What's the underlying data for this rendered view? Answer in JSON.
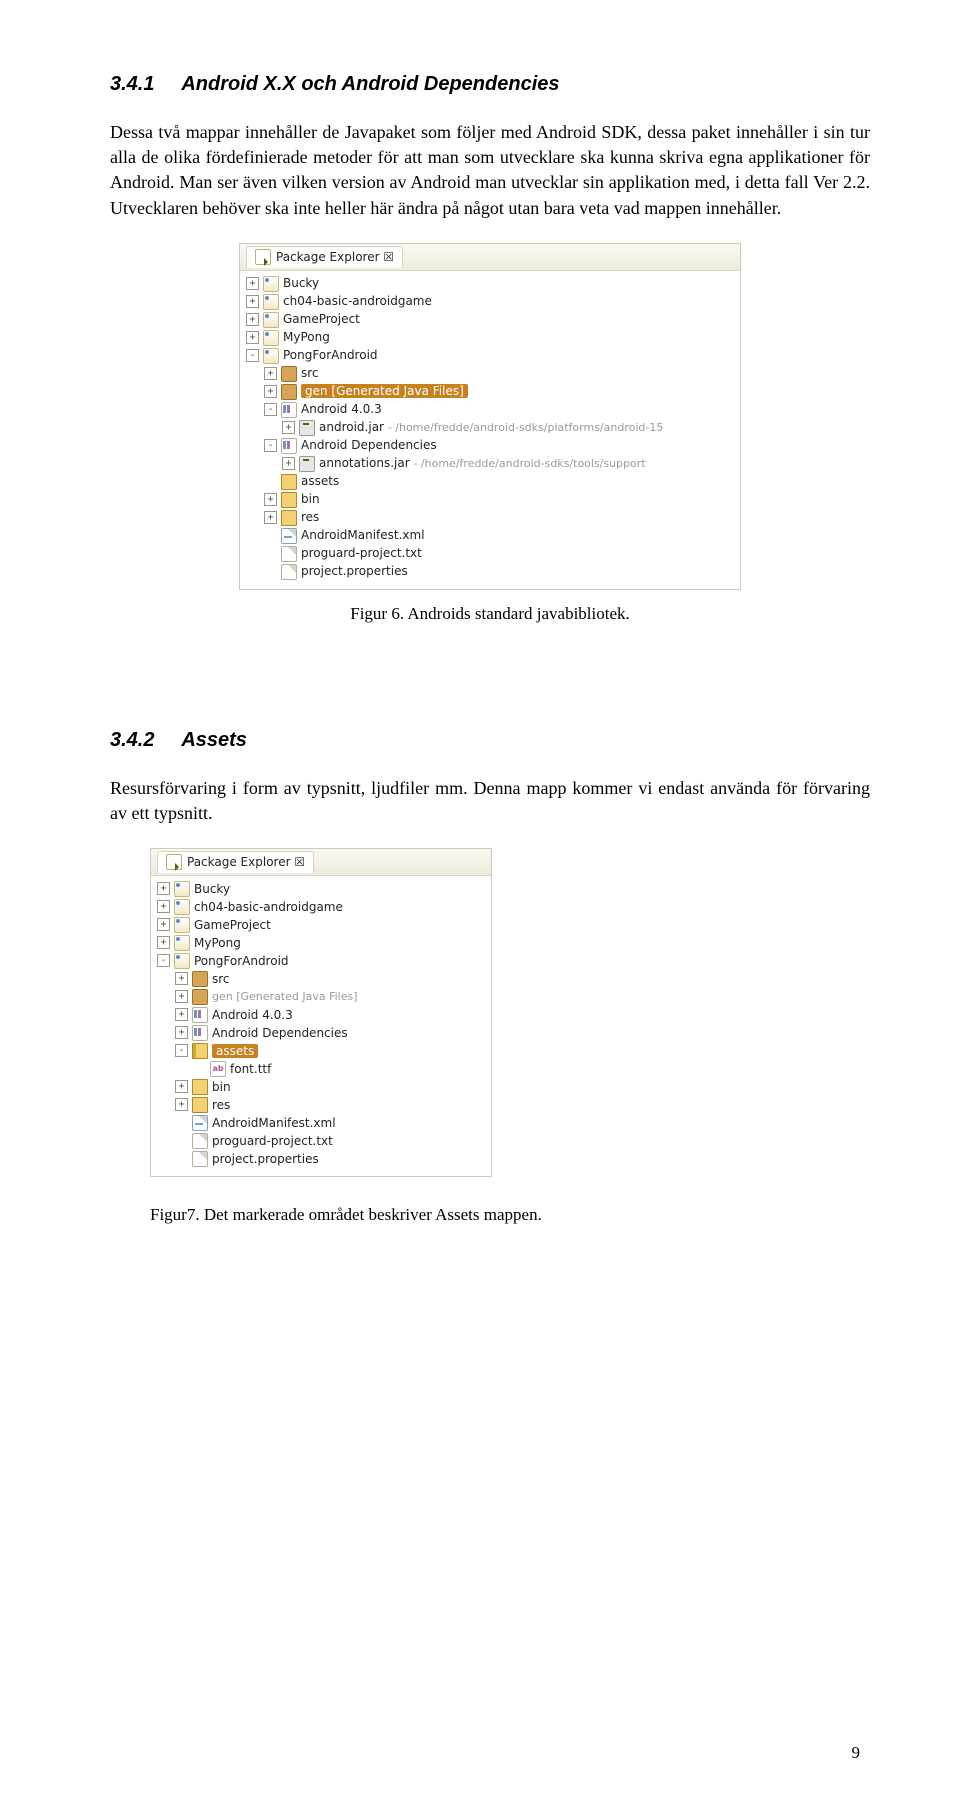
{
  "heading1": {
    "num": "3.4.1",
    "title": "Android X.X och Android Dependencies"
  },
  "para1": "Dessa två mappar innehåller de Javapaket som följer med Android SDK, dessa paket innehåller i sin tur alla de olika fördefinierade metoder för att man som utvecklare ska kunna skriva egna applikationer för Android. Man ser även vilken version av Android man utvecklar sin applikation med, i detta fall Ver 2.2. Utvecklaren behöver ska inte heller här ändra på något utan bara veta vad mappen innehåller.",
  "caption1": "Figur 6. Androids standard javabibliotek.",
  "heading2": {
    "num": "3.4.2",
    "title": "Assets"
  },
  "para2": "Resursförvaring i form av typsnitt, ljudfiler mm. Denna mapp kommer vi endast använda för förvaring av ett typsnitt.",
  "caption2": "Figur7. Det markerade området beskriver Assets mappen.",
  "pageNumber": "9",
  "explorer": {
    "tabTitle": "Package Explorer",
    "projects": [
      "Bucky",
      "ch04-basic-androidgame",
      "GameProject",
      "MyPong",
      "PongForAndroid"
    ],
    "srcLabel": "src",
    "genLabel": "gen [Generated Java Files]",
    "androidVer": "Android 4.0.3",
    "androidJar": "android.jar",
    "androidJarPath": "- /home/fredde/android-sdks/platforms/android-15",
    "androidDeps": "Android Dependencies",
    "annotationsJar": "annotations.jar",
    "annotationsJarPath": "- /home/fredde/android-sdks/tools/support",
    "assets": "assets",
    "bin": "bin",
    "res": "res",
    "manifest": "AndroidManifest.xml",
    "proguard": "proguard-project.txt",
    "projprops": "project.properties",
    "fontFile": "font.ttf"
  }
}
